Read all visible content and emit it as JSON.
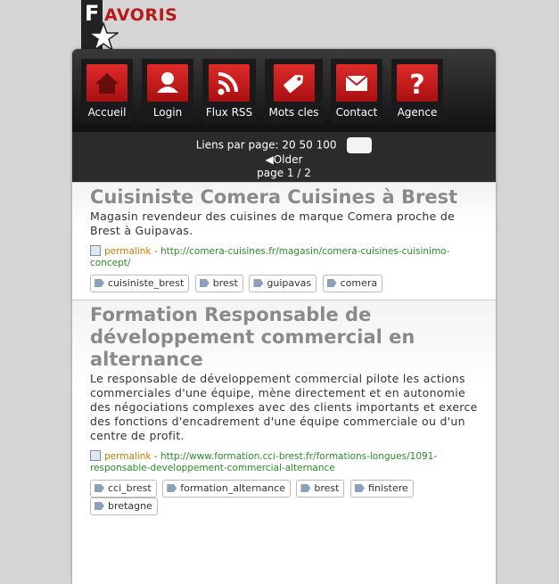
{
  "logo": {
    "letter": "F",
    "word": "AVORIS"
  },
  "nav": [
    {
      "label": "Accueil",
      "icon": "home-icon"
    },
    {
      "label": "Login",
      "icon": "user-icon"
    },
    {
      "label": "Flux RSS",
      "icon": "rss-icon"
    },
    {
      "label": "Mots cles",
      "icon": "tag-icon"
    },
    {
      "label": "Contact",
      "icon": "mail-icon"
    },
    {
      "label": "Agence",
      "icon": "question-icon"
    }
  ],
  "paging": {
    "links_per_page_label": "Liens par page:",
    "options": [
      "20",
      "50",
      "100"
    ],
    "older": "◀Older",
    "page": "page 1 / 2"
  },
  "entries": [
    {
      "title": "Cuisiniste Comera Cuisines à Brest",
      "desc": "Magasin revendeur des cuisines de marque Comera proche de Brest à Guipavas.",
      "permalink": "permalink",
      "url": " - http://comera-cuisines.fr/magasin/comera-cuisines-cuisinimo-concept/",
      "tags": [
        "cuisiniste_brest",
        "brest",
        "guipavas",
        "comera"
      ]
    },
    {
      "title": "Formation Responsable de développement commercial en alternance",
      "desc": "Le responsable de développement commercial pilote les actions commerciales d'une équipe, mène directement et en autonomie des négociations complexes avec des clients importants et exerce des fonctions d'encadrement d'une équipe commerciale ou d'un centre de profit.",
      "permalink": "permalink",
      "url": " - http://www.formation.cci-brest.fr/formations-longues/1091-responsable-developpement-commercial-alternance",
      "tags": [
        "cci_brest",
        "formation_alternance",
        "brest",
        "finistere",
        "bretagne"
      ]
    }
  ],
  "colors": {
    "accent": "#b81a1a",
    "link": "#2b8b2b",
    "permalink": "#c87a00"
  }
}
